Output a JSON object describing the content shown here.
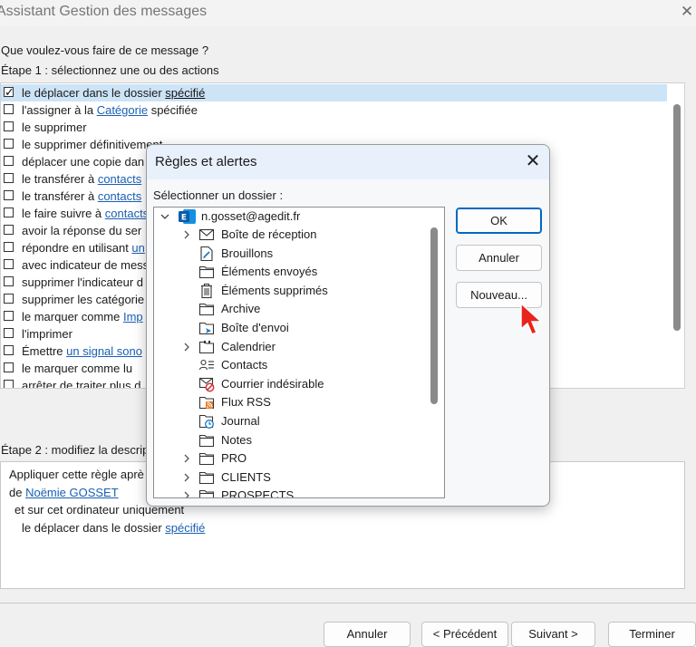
{
  "wizard": {
    "title": "Assistant Gestion des messages",
    "question": "Que voulez-vous faire de ce message ?",
    "step1_label": "Étape 1 : sélectionnez une ou des actions",
    "actions": [
      {
        "pre": "le déplacer dans le dossier ",
        "link": "spécifié",
        "post": "",
        "checked": true
      },
      {
        "pre": "l'assigner à la ",
        "link": "Catégorie",
        "post": " spécifiée",
        "checked": false
      },
      {
        "pre": "le supprimer",
        "link": "",
        "post": "",
        "checked": false
      },
      {
        "pre": "le supprimer définitivement",
        "link": "",
        "post": "",
        "checked": false
      },
      {
        "pre": "déplacer une copie dan",
        "link": "",
        "post": "",
        "checked": false
      },
      {
        "pre": "le transférer à ",
        "link": "contacts",
        "post": "",
        "checked": false
      },
      {
        "pre": "le transférer à ",
        "link": "contacts",
        "post": "",
        "checked": false
      },
      {
        "pre": "le faire suivre à ",
        "link": "contacts",
        "post": "",
        "checked": false
      },
      {
        "pre": "avoir la réponse du ser",
        "link": "",
        "post": "",
        "checked": false
      },
      {
        "pre": "répondre en utilisant ",
        "link": "un",
        "post": "",
        "checked": false
      },
      {
        "pre": "avec indicateur de mess",
        "link": "",
        "post": "",
        "checked": false
      },
      {
        "pre": "supprimer l'indicateur d",
        "link": "",
        "post": "",
        "checked": false
      },
      {
        "pre": "supprimer les catégorie",
        "link": "",
        "post": "",
        "checked": false
      },
      {
        "pre": "le marquer comme ",
        "link": "Imp",
        "post": "",
        "checked": false
      },
      {
        "pre": "l'imprimer",
        "link": "",
        "post": "",
        "checked": false
      },
      {
        "pre": "Émettre ",
        "link": "un signal sono",
        "post": "",
        "checked": false
      },
      {
        "pre": "le marquer comme lu",
        "link": "",
        "post": "",
        "checked": false
      },
      {
        "pre": "arrêter de traiter plus d",
        "link": "",
        "post": "",
        "checked": false
      }
    ],
    "step2_label": "Étape 2 : modifiez la descrip",
    "description": {
      "line1": "Appliquer cette règle aprè",
      "line2_pre": "de ",
      "line2_link": "Noëmie GOSSET",
      "line3": "et sur cet ordinateur uniquement",
      "line4_pre": "le déplacer dans le dossier ",
      "line4_link": "spécifié"
    },
    "buttons": {
      "cancel": "Annuler",
      "previous": "< Précédent",
      "next": "Suivant >",
      "finish": "Terminer"
    }
  },
  "dialog": {
    "title": "Règles et alertes",
    "select_label": "Sélectionner un dossier :",
    "account": "n.gosset@agedit.fr",
    "folders": [
      {
        "label": "Boîte de réception",
        "icon": "envelope-icon",
        "expandable": true
      },
      {
        "label": "Brouillons",
        "icon": "draft-icon",
        "expandable": false
      },
      {
        "label": "Éléments envoyés",
        "icon": "folder-icon",
        "expandable": false
      },
      {
        "label": "Éléments supprimés",
        "icon": "trash-icon",
        "expandable": false
      },
      {
        "label": "Archive",
        "icon": "folder-icon",
        "expandable": false
      },
      {
        "label": "Boîte d'envoi",
        "icon": "outbox-icon",
        "expandable": false
      },
      {
        "label": "Calendrier",
        "icon": "calendar-icon",
        "expandable": true
      },
      {
        "label": "Contacts",
        "icon": "contacts-icon",
        "expandable": false
      },
      {
        "label": "Courrier indésirable",
        "icon": "junk-mail-icon",
        "expandable": false
      },
      {
        "label": "Flux RSS",
        "icon": "rss-icon",
        "expandable": false
      },
      {
        "label": "Journal",
        "icon": "journal-icon",
        "expandable": false
      },
      {
        "label": "Notes",
        "icon": "notes-icon",
        "expandable": false
      },
      {
        "label": "PRO",
        "icon": "folder-icon",
        "expandable": true
      },
      {
        "label": "CLIENTS",
        "icon": "folder-icon",
        "expandable": true
      },
      {
        "label": "PROSPECTS",
        "icon": "folder-icon",
        "expandable": true
      }
    ],
    "buttons": {
      "ok": "OK",
      "cancel": "Annuler",
      "new": "Nouveau..."
    }
  },
  "colors": {
    "link": "#1a5fb4",
    "selection": "#cde4f7",
    "primary_border": "#0067c0",
    "cursor": "#e8241c"
  }
}
